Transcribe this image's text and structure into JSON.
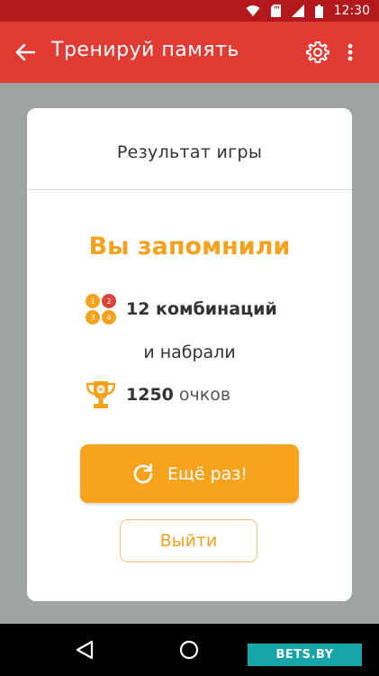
{
  "status_bar": {
    "time": "12:30",
    "icons": [
      "wifi-icon",
      "sd-card-icon",
      "signal-icon",
      "battery-icon"
    ]
  },
  "app_bar": {
    "title": "Тренируй память",
    "back_icon": "arrow-left-icon",
    "settings_icon": "gear-icon",
    "more_icon": "more-vertical-icon",
    "color": "#e23b34"
  },
  "dialog": {
    "title": "Результат игры",
    "headline": "Вы запомнили",
    "combinations_icon": "combination-dots-icon",
    "combinations_text": "12 комбинаций",
    "and_text": "и набрали",
    "score_icon": "trophy-icon",
    "score_value": "1250",
    "score_unit": "очков",
    "retry_button": "Ещё раз!",
    "retry_icon": "refresh-icon",
    "exit_button": "Выйти",
    "accent_color": "#f7a31d"
  },
  "nav_bar": {
    "back_icon": "nav-back-triangle-icon",
    "home_icon": "nav-home-circle-icon"
  },
  "watermark": {
    "text": "BETS.BY"
  }
}
